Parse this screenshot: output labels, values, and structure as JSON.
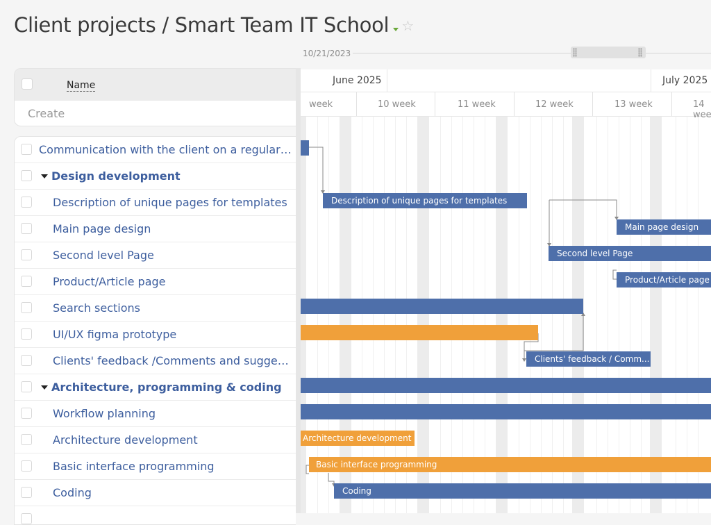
{
  "header": {
    "title": "Client projects / Smart Team IT School",
    "star_icon": "☆"
  },
  "timeline": {
    "date_label": "10/21/2023"
  },
  "left_panel": {
    "column_name": "Name",
    "create_placeholder": "Create"
  },
  "tasks": [
    {
      "label": "Communication with the client on a regular basis",
      "group": false,
      "level": 0
    },
    {
      "label": "Design development",
      "group": true,
      "level": 0
    },
    {
      "label": "Description of unique pages for templates",
      "group": false,
      "level": 1
    },
    {
      "label": "Main page design",
      "group": false,
      "level": 1
    },
    {
      "label": "Second level Page",
      "group": false,
      "level": 1
    },
    {
      "label": "Product/Article page",
      "group": false,
      "level": 1
    },
    {
      "label": "Search sections",
      "group": false,
      "level": 1
    },
    {
      "label": "UI/UX figma prototype",
      "group": false,
      "level": 1
    },
    {
      "label": "Clients' feedback /Comments and suggestions",
      "group": false,
      "level": 1
    },
    {
      "label": "Architecture, programming & coding",
      "group": true,
      "level": 0
    },
    {
      "label": "Workflow planning",
      "group": false,
      "level": 1
    },
    {
      "label": "Architecture development",
      "group": false,
      "level": 1
    },
    {
      "label": "Basic interface programming",
      "group": false,
      "level": 1
    },
    {
      "label": "Coding",
      "group": false,
      "level": 1
    }
  ],
  "gantt": {
    "months": [
      "June 2025",
      "July 2025"
    ],
    "weeks": [
      "week",
      "10 week",
      "11 week",
      "12 week",
      "13 week",
      "14 week"
    ],
    "bars": [
      {
        "label": "",
        "color": "#4e6faa"
      },
      {
        "label": "Description of unique pages for templates",
        "color": "#4e6faa"
      },
      {
        "label": "Main page design",
        "color": "#4e6faa"
      },
      {
        "label": "Second level Page",
        "color": "#4e6faa"
      },
      {
        "label": "Product/Article page",
        "color": "#4e6faa"
      },
      {
        "label": "",
        "color": "#4e6faa"
      },
      {
        "label": "",
        "color": "#f0a03a"
      },
      {
        "label": "Clients' feedback / Comm...",
        "color": "#4e6faa"
      },
      {
        "label": "",
        "color": "#4e6faa"
      },
      {
        "label": "",
        "color": "#4e6faa"
      },
      {
        "label": "Architecture development",
        "color": "#f0a03a"
      },
      {
        "label": "Basic interface programming",
        "color": "#f0a03a"
      },
      {
        "label": "Coding",
        "color": "#4e6faa"
      }
    ]
  }
}
